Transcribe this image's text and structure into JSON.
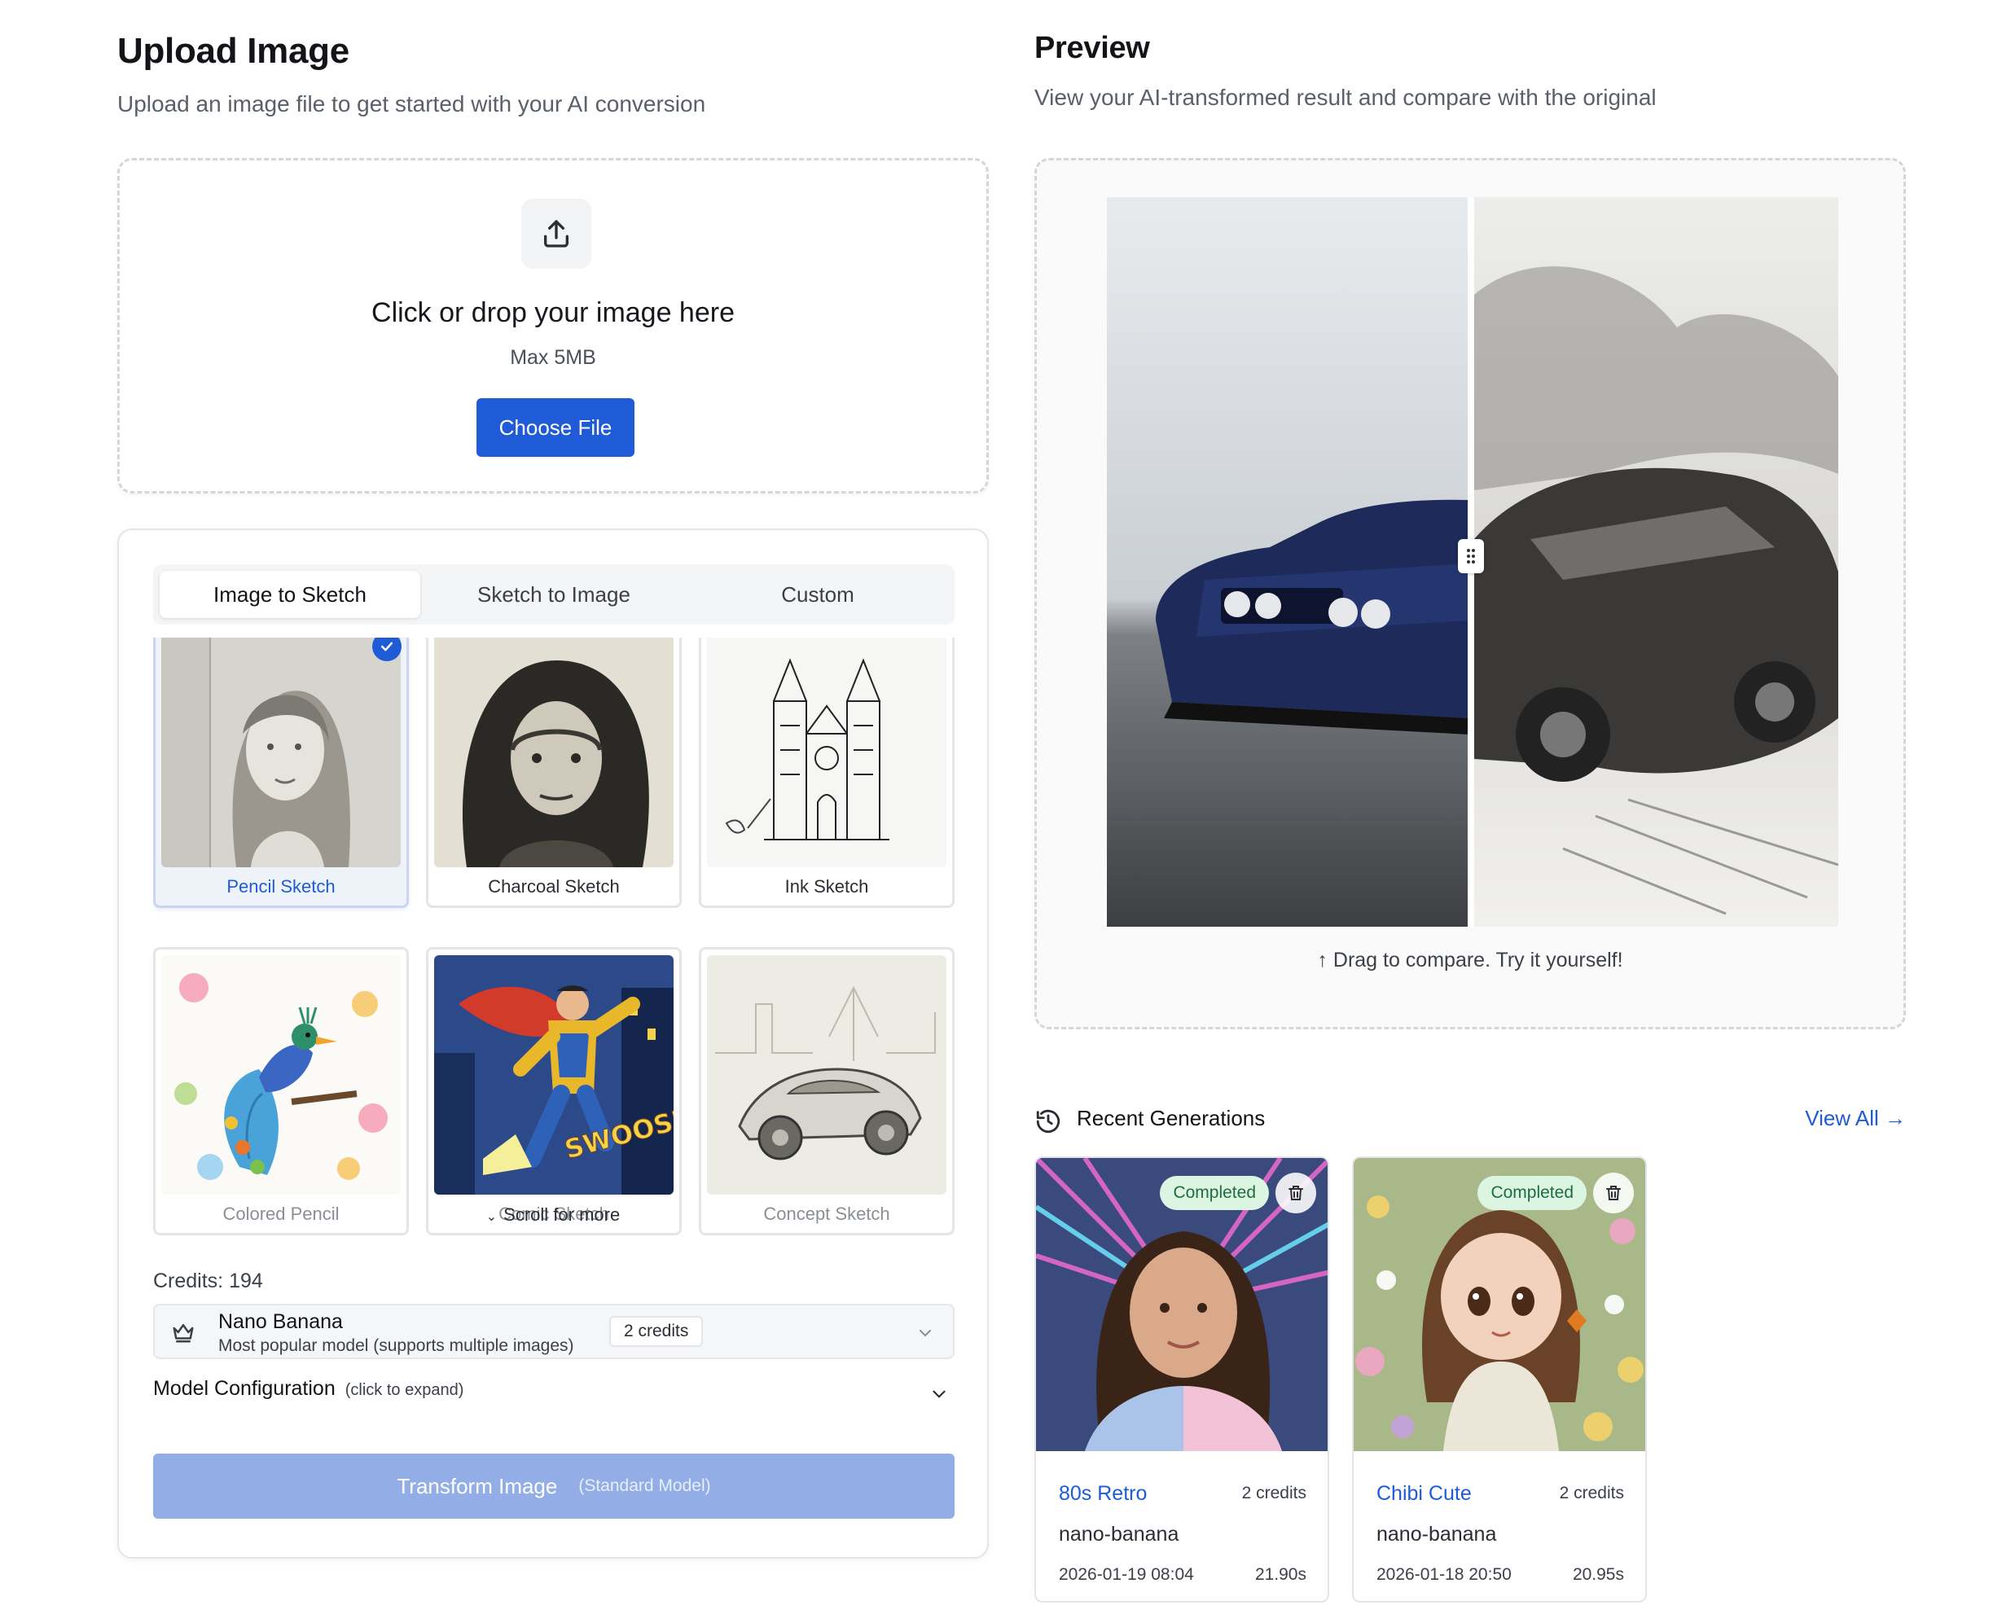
{
  "upload": {
    "title": "Upload Image",
    "subtitle": "Upload an image file to get started with your AI conversion",
    "icon": "upload-icon",
    "drop_text": "Click or drop your image here",
    "max_size": "Max 5MB",
    "choose_button": "Choose File"
  },
  "tabs": [
    {
      "label": "Image to Sketch",
      "active": true
    },
    {
      "label": "Sketch to Image",
      "active": false
    },
    {
      "label": "Custom",
      "active": false
    }
  ],
  "styles": [
    {
      "label": "Pencil Sketch",
      "selected": true,
      "icon": "pencil-portrait-thumb"
    },
    {
      "label": "Charcoal Sketch",
      "selected": false,
      "icon": "charcoal-portrait-thumb"
    },
    {
      "label": "Ink Sketch",
      "selected": false,
      "icon": "ink-cathedral-thumb"
    },
    {
      "label": "Colored Pencil",
      "selected": false,
      "icon": "peacock-thumb"
    },
    {
      "label": "Comic Sketch",
      "selected": false,
      "icon": "comic-hero-thumb"
    },
    {
      "label": "Concept Sketch",
      "selected": false,
      "icon": "concept-car-thumb"
    }
  ],
  "scroll_hint": "Scroll for more",
  "credits_text": "Credits: 194",
  "model": {
    "name": "Nano Banana",
    "description": "Most popular model (supports multiple images)",
    "credits": "2 credits",
    "icon": "crown-icon"
  },
  "model_config": {
    "label": "Model Configuration",
    "hint": "(click to expand)"
  },
  "transform": {
    "label": "Transform Image",
    "sub": "(Standard Model)"
  },
  "preview": {
    "title": "Preview",
    "subtitle": "View your AI-transformed result and compare with the original",
    "hint": "↑ Drag to compare. Try it yourself!"
  },
  "recent": {
    "title": "Recent Generations",
    "view_all": "View All →",
    "items": [
      {
        "name": "80s Retro",
        "cost": "2 credits",
        "model": "nano-banana",
        "date": "2026-01-19 08:04",
        "duration": "21.90s",
        "status": "Completed"
      },
      {
        "name": "Chibi Cute",
        "cost": "2 credits",
        "model": "nano-banana",
        "date": "2026-01-18 20:50",
        "duration": "20.95s",
        "status": "Completed"
      }
    ]
  },
  "colors": {
    "accent": "#1f5bd6",
    "button_disabled": "#93aee6",
    "status_bg": "#dcf5e3",
    "status_text": "#1d6e3b"
  }
}
